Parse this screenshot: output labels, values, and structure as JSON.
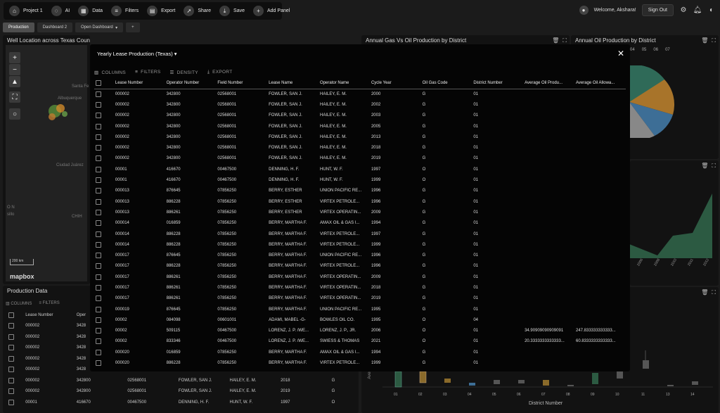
{
  "toolbar": {
    "project": "Project 1",
    "ai": "AI",
    "data": "Data",
    "filters": "Filters",
    "export": "Export",
    "share": "Share",
    "save": "Save",
    "add_panel": "Add Panel"
  },
  "user": {
    "welcome": "Welcome, Akshara!",
    "sign_out": "Sign Out"
  },
  "tabs": [
    "Production",
    "Dashboard 2",
    "Open Dashboard",
    "+"
  ],
  "panels": {
    "well_location": "Well Location across Texas Counties",
    "annual_gas_oil": "Annual Gas Vs Oil Production by District",
    "annual_oil": "Annual Oil Production by District",
    "production_data": "Production Data"
  },
  "map": {
    "labels": [
      "Santa Fe",
      "Albuquerque",
      "Ciudad Juárez",
      "CHIH",
      "O N",
      "sillo"
    ],
    "scale": "200 km",
    "brand": "mapbox"
  },
  "pie_legend": [
    "04",
    "05",
    "06",
    "07"
  ],
  "area_ticks": [
    "2006",
    "2008",
    "2010",
    "2011",
    "2012"
  ],
  "box_ticks": [
    "01",
    "02",
    "03",
    "04",
    "05",
    "06",
    "07",
    "08",
    "09",
    "10",
    "11",
    "13",
    "14"
  ],
  "box_xlabel": "District Number",
  "box_ylabel": "Avera",
  "modal": {
    "title": "Yearly Lease Production (Texas)",
    "tools": [
      "COLUMNS",
      "FILTERS",
      "DENSITY",
      "EXPORT"
    ],
    "columns": [
      "Lease Number",
      "Operator Number",
      "Field Number",
      "Lease Name",
      "Operator Name",
      "Cycle Year",
      "Oil Gas Code",
      "District Number",
      "Average Oil Produ...",
      "Average Oil Allowa..."
    ],
    "rows": [
      [
        "000002",
        "342800",
        "02568001",
        "FOWLER, SAN J.",
        "HAILEY, E. M.",
        "2000",
        "G",
        "01",
        "",
        ""
      ],
      [
        "000002",
        "342800",
        "02568001",
        "FOWLER, SAN J.",
        "HAILEY, E. M.",
        "2002",
        "G",
        "01",
        "",
        ""
      ],
      [
        "000002",
        "342800",
        "02568001",
        "FOWLER, SAN J.",
        "HAILEY, E. M.",
        "2003",
        "G",
        "01",
        "",
        ""
      ],
      [
        "000002",
        "342800",
        "02568001",
        "FOWLER, SAN J.",
        "HAILEY, E. M.",
        "2005",
        "G",
        "01",
        "",
        ""
      ],
      [
        "000002",
        "342800",
        "02568001",
        "FOWLER, SAN J.",
        "HAILEY, E. M.",
        "2013",
        "G",
        "01",
        "",
        ""
      ],
      [
        "000002",
        "342800",
        "02568001",
        "FOWLER, SAN J.",
        "HAILEY, E. M.",
        "2018",
        "G",
        "01",
        "",
        ""
      ],
      [
        "000002",
        "342800",
        "02568001",
        "FOWLER, SAN J.",
        "HAILEY, E. M.",
        "2019",
        "G",
        "01",
        "",
        ""
      ],
      [
        "00001",
        "416670",
        "00467500",
        "DENNING, H. F.",
        "HUNT, W. F.",
        "1997",
        "O",
        "01",
        "",
        ""
      ],
      [
        "00001",
        "416670",
        "00467500",
        "DENNING, H. F.",
        "HUNT, W. F.",
        "1999",
        "O",
        "01",
        "",
        ""
      ],
      [
        "000013",
        "876645",
        "07856250",
        "BERRY, ESTHER",
        "UNION PACIFIC RE...",
        "1996",
        "G",
        "01",
        "",
        ""
      ],
      [
        "000013",
        "886228",
        "07856250",
        "BERRY, ESTHER",
        "VIRTEX PETROLE...",
        "1996",
        "G",
        "01",
        "",
        ""
      ],
      [
        "000013",
        "886261",
        "07856250",
        "BERRY, ESTHER",
        "VIRTEX OPERATIN...",
        "2009",
        "G",
        "01",
        "",
        ""
      ],
      [
        "000014",
        "016859",
        "07856250",
        "BERRY, MARTHA F.",
        "AMAX OIL & GAS I...",
        "1994",
        "G",
        "01",
        "",
        ""
      ],
      [
        "000014",
        "886228",
        "07856250",
        "BERRY, MARTHA F.",
        "VIRTEX PETROLE...",
        "1997",
        "G",
        "01",
        "",
        ""
      ],
      [
        "000014",
        "886228",
        "07856250",
        "BERRY, MARTHA F.",
        "VIRTEX PETROLE...",
        "1999",
        "G",
        "01",
        "",
        ""
      ],
      [
        "000017",
        "876645",
        "07856250",
        "BERRY, MARTHA F.",
        "UNION PACIFIC RE...",
        "1996",
        "G",
        "01",
        "",
        ""
      ],
      [
        "000017",
        "886228",
        "07856250",
        "BERRY, MARTHA F.",
        "VIRTEX PETROLE...",
        "1996",
        "G",
        "01",
        "",
        ""
      ],
      [
        "000017",
        "886261",
        "07856250",
        "BERRY, MARTHA F.",
        "VIRTEX OPERATIN...",
        "2009",
        "G",
        "01",
        "",
        ""
      ],
      [
        "000017",
        "886261",
        "07856250",
        "BERRY, MARTHA F.",
        "VIRTEX OPERATIN...",
        "2018",
        "G",
        "01",
        "",
        ""
      ],
      [
        "000017",
        "886261",
        "07856250",
        "BERRY, MARTHA F.",
        "VIRTEX OPERATIN...",
        "2019",
        "G",
        "01",
        "",
        ""
      ],
      [
        "000019",
        "876645",
        "07856250",
        "BERRY, MARTHA F.",
        "UNION PACIFIC RE...",
        "1995",
        "G",
        "01",
        "",
        ""
      ],
      [
        "00002",
        "084098",
        "00601001",
        "ADAMI, MABEL -G-",
        "BOWLES OIL CO.",
        "1995",
        "O",
        "04",
        "",
        ""
      ],
      [
        "00002",
        "509115",
        "00467500",
        "LORENZ, J. P. /WE...",
        "LORENZ, J. P., JR.",
        "2006",
        "O",
        "01",
        "34.90909090909091",
        "247.833333333333..."
      ],
      [
        "00002",
        "833346",
        "00467500",
        "LORENZ, J. P. /WE...",
        "SWIESS & THOMAS",
        "2021",
        "O",
        "01",
        "20.3333333333333...",
        "60.8333333333333..."
      ],
      [
        "000020",
        "016859",
        "07856250",
        "BERRY, MARTHA F.",
        "AMAX OIL & GAS I...",
        "1994",
        "G",
        "01",
        "",
        ""
      ],
      [
        "000020",
        "886228",
        "07856250",
        "BERRY, MARTHA F.",
        "VIRTEX PETROLE...",
        "1999",
        "G",
        "01",
        "",
        ""
      ]
    ]
  },
  "production_data": {
    "tools": [
      "COLUMNS",
      "FILTERS"
    ],
    "columns": [
      "Lease Number",
      "Oper"
    ],
    "rows": [
      [
        "000002",
        "3428",
        "",
        "",
        "",
        "",
        ""
      ],
      [
        "000002",
        "3428",
        "",
        "",
        "",
        "",
        ""
      ],
      [
        "000002",
        "3428",
        "",
        "",
        "",
        "",
        ""
      ],
      [
        "000002",
        "3428",
        "",
        "",
        "",
        "",
        ""
      ],
      [
        "000002",
        "3428",
        "",
        "",
        "",
        "",
        ""
      ],
      [
        "000002",
        "342800",
        "02568001",
        "FOWLER, SAN J.",
        "HAILEY, E. M.",
        "2018",
        "G"
      ],
      [
        "000002",
        "342800",
        "02568001",
        "FOWLER, SAN J.",
        "HAILEY, E. M.",
        "2019",
        "G"
      ],
      [
        "00001",
        "416670",
        "00467500",
        "DENNING, H. F.",
        "HUNT, W. F.",
        "1997",
        "O"
      ]
    ]
  }
}
